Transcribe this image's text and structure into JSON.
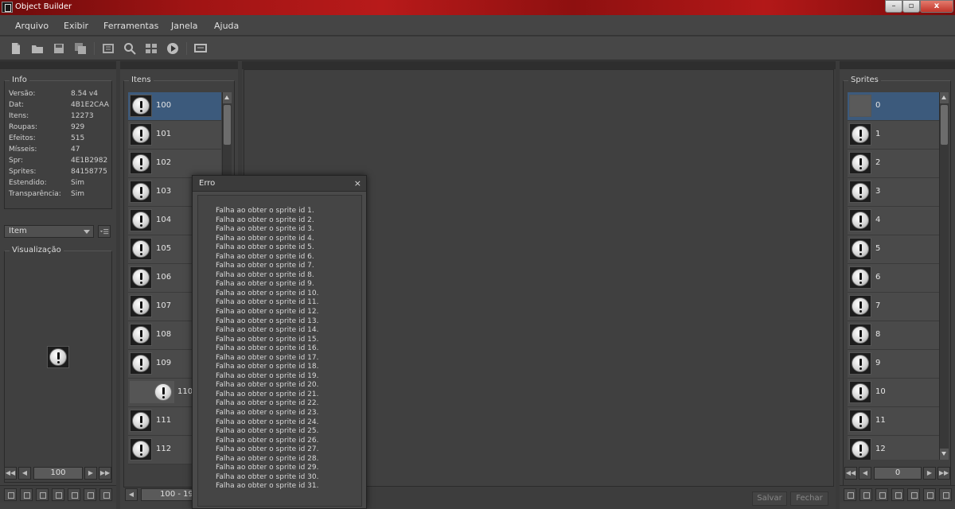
{
  "window": {
    "title": "Object Builder",
    "min_label": "–",
    "max_label": "▫",
    "close_label": "x"
  },
  "menu": [
    "Arquivo",
    "Exibir",
    "Ferramentas",
    "Janela",
    "Ajuda"
  ],
  "toolbar_icons": [
    "new-file-icon",
    "open-folder-icon",
    "save-icon",
    "save-as-icon",
    "compile-icon",
    "search-icon",
    "grid-icon",
    "play-icon",
    "monitor-icon"
  ],
  "info": {
    "legend": "Info",
    "rows": [
      {
        "label": "Versão:",
        "value": "8.54 v4"
      },
      {
        "label": "Dat:",
        "value": "4B1E2CAA"
      },
      {
        "label": "Itens:",
        "value": "12273"
      },
      {
        "label": "Roupas:",
        "value": "929"
      },
      {
        "label": "Efeitos:",
        "value": "515"
      },
      {
        "label": "Mísseis:",
        "value": "47"
      },
      {
        "label": "Spr:",
        "value": "4E1B2982"
      },
      {
        "label": "Sprites:",
        "value": "84158775"
      },
      {
        "label": "Estendido:",
        "value": "Sim"
      },
      {
        "label": "Transparência:",
        "value": "Sim"
      }
    ]
  },
  "category": {
    "selected": "Item"
  },
  "preview": {
    "legend": "Visualização"
  },
  "left_pager": {
    "value": "100"
  },
  "items": {
    "legend": "Itens",
    "rows": [
      "100",
      "101",
      "102",
      "103",
      "104",
      "105",
      "106",
      "107",
      "108",
      "109",
      "110",
      "111",
      "112"
    ],
    "selected": "100",
    "pager_value": "100 - 19"
  },
  "sprites": {
    "legend": "Sprites",
    "rows": [
      "0",
      "1",
      "2",
      "3",
      "4",
      "5",
      "6",
      "7",
      "8",
      "9",
      "10",
      "11",
      "12"
    ],
    "selected": "0",
    "pager_value": "0"
  },
  "editor": {
    "save_label": "Salvar",
    "close_label": "Fechar"
  },
  "dialog": {
    "title": "Erro",
    "close": "×",
    "messages": [
      "Falha ao obter o sprite id 1.",
      "Falha ao obter o sprite id 2.",
      "Falha ao obter o sprite id 3.",
      "Falha ao obter o sprite id 4.",
      "Falha ao obter o sprite id 5.",
      "Falha ao obter o sprite id 6.",
      "Falha ao obter o sprite id 7.",
      "Falha ao obter o sprite id 8.",
      "Falha ao obter o sprite id 9.",
      "Falha ao obter o sprite id 10.",
      "Falha ao obter o sprite id 11.",
      "Falha ao obter o sprite id 12.",
      "Falha ao obter o sprite id 13.",
      "Falha ao obter o sprite id 14.",
      "Falha ao obter o sprite id 15.",
      "Falha ao obter o sprite id 16.",
      "Falha ao obter o sprite id 17.",
      "Falha ao obter o sprite id 18.",
      "Falha ao obter o sprite id 19.",
      "Falha ao obter o sprite id 20.",
      "Falha ao obter o sprite id 21.",
      "Falha ao obter o sprite id 22.",
      "Falha ao obter o sprite id 23.",
      "Falha ao obter o sprite id 24.",
      "Falha ao obter o sprite id 25.",
      "Falha ao obter o sprite id 26.",
      "Falha ao obter o sprite id 27.",
      "Falha ao obter o sprite id 28.",
      "Falha ao obter o sprite id 29.",
      "Falha ao obter o sprite id 30.",
      "Falha ao obter o sprite id 31."
    ]
  }
}
